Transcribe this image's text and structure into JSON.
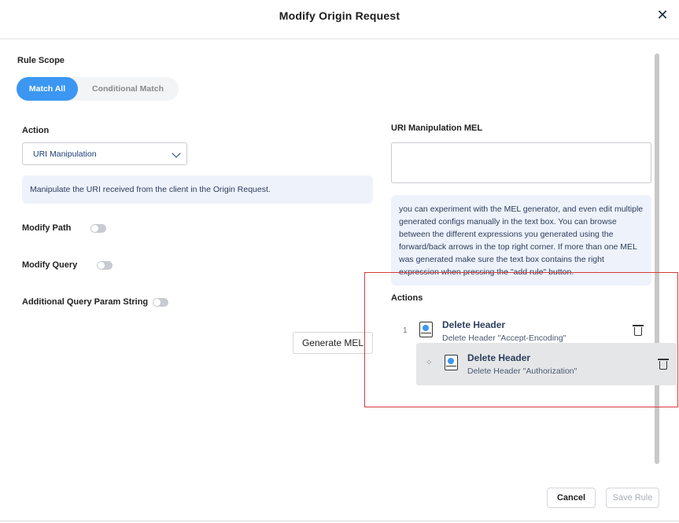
{
  "dialog": {
    "title": "Modify Origin Request",
    "close_icon": "✕"
  },
  "rule_scope": {
    "label": "Rule Scope",
    "options": [
      "Match All",
      "Conditional Match"
    ],
    "selected": "Match All"
  },
  "action": {
    "label": "Action",
    "selected": "URI Manipulation",
    "description": "Manipulate the URI received from the client in the Origin Request."
  },
  "toggles": [
    {
      "label": "Modify Path",
      "on": false
    },
    {
      "label": "Modify Query",
      "on": false
    },
    {
      "label": "Additional Query Param String",
      "on": false
    }
  ],
  "generate_button": "Generate MEL",
  "mel": {
    "label": "URI Manipulation MEL",
    "value": "",
    "help": "you can experiment with the MEL generator, and even edit multiple generated configs manually in the text box. You can browse between the different expressions you generated using the forward/back arrows in the top right corner. If more than one MEL was generated make sure the text box contains the right expression when pressing the \"add rule\" button."
  },
  "actions": {
    "label": "Actions",
    "items": [
      {
        "index": "1",
        "title": "Delete Header",
        "subtitle": "Delete Header \"Accept-Encoding\""
      },
      {
        "index": "",
        "title": "Delete Header",
        "subtitle": "Delete Header \"Authorization\"",
        "dragging": true
      }
    ]
  },
  "footer": {
    "cancel": "Cancel",
    "save": "Save Rule"
  },
  "colors": {
    "accent": "#3b97f2",
    "highlight": "#d63a3a"
  }
}
